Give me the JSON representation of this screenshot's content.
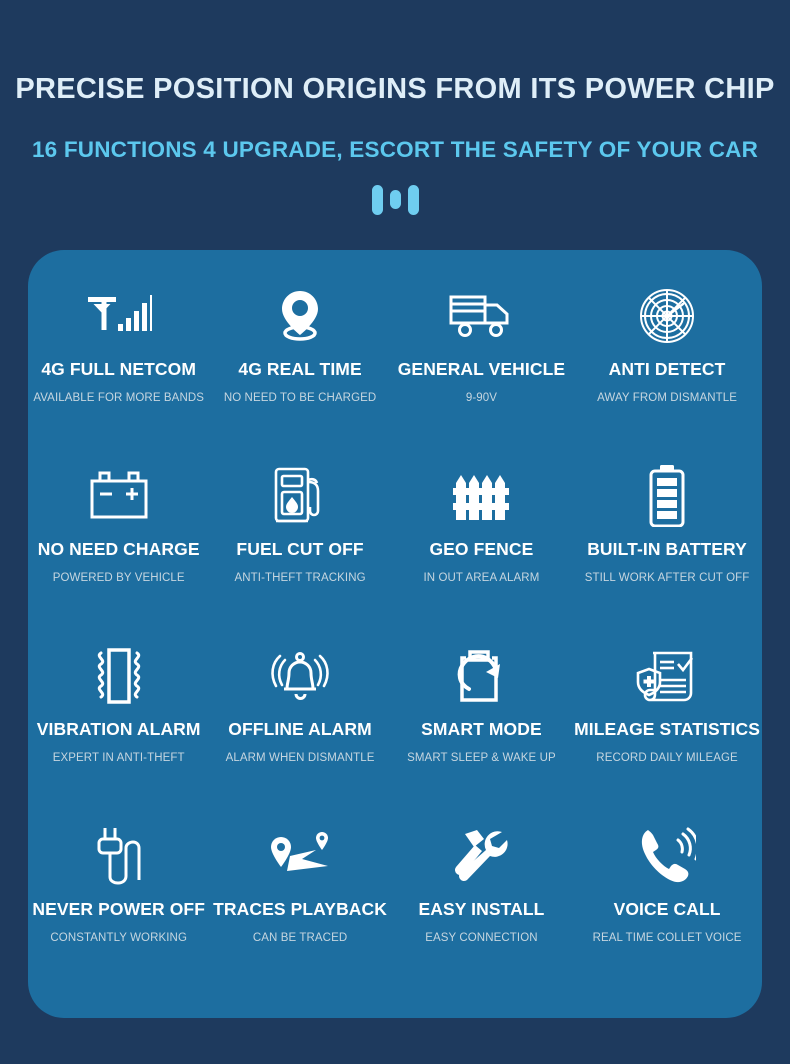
{
  "header": {
    "headline": "PRECISE POSITION ORIGINS FROM ITS POWER CHIP",
    "subheadline": "16 FUNCTIONS 4 UPGRADE, ESCORT THE SAFETY OF YOUR CAR",
    "decoration": "three-bar-mark"
  },
  "colors": {
    "page_background": "#1e3a5e",
    "card_background": "#1d6ea0",
    "headline_text": "#dfeef8",
    "subheadline_text": "#5cc8ee",
    "accent": "#6fcdf0",
    "feature_title_text": "#ffffff",
    "feature_subtitle_text": "#c6d6e0"
  },
  "features": [
    {
      "icon": "signal-bars-icon",
      "title": "4G FULL NETCOM",
      "subtitle": "AVAILABLE FOR MORE BANDS"
    },
    {
      "icon": "location-pin-icon",
      "title": "4G REAL TIME",
      "subtitle": "NO NEED TO BE CHARGED"
    },
    {
      "icon": "truck-icon",
      "title": "GENERAL VEHICLE",
      "subtitle": "9-90V"
    },
    {
      "icon": "radar-icon",
      "title": "ANTI DETECT",
      "subtitle": "AWAY FROM DISMANTLE"
    },
    {
      "icon": "car-battery-icon",
      "title": "NO NEED CHARGE",
      "subtitle": "POWERED BY VEHICLE"
    },
    {
      "icon": "fuel-pump-icon",
      "title": "FUEL CUT OFF",
      "subtitle": "ANTI-THEFT TRACKING"
    },
    {
      "icon": "fence-icon",
      "title": "GEO FENCE",
      "subtitle": "IN OUT AREA ALARM"
    },
    {
      "icon": "battery-icon",
      "title": "BUILT-IN BATTERY",
      "subtitle": "STILL WORK AFTER CUT OFF"
    },
    {
      "icon": "vibration-icon",
      "title": "VIBRATION ALARM",
      "subtitle": "EXPERT IN ANTI-THEFT"
    },
    {
      "icon": "ringing-bell-icon",
      "title": "OFFLINE ALARM",
      "subtitle": "ALARM WHEN DISMANTLE"
    },
    {
      "icon": "clipboard-refresh-icon",
      "title": "SMART MODE",
      "subtitle": "SMART SLEEP & WAKE UP"
    },
    {
      "icon": "document-check-icon",
      "title": "MILEAGE STATISTICS",
      "subtitle": "RECORD DAILY MILEAGE"
    },
    {
      "icon": "power-plug-icon",
      "title": "NEVER POWER OFF",
      "subtitle": "CONSTANTLY WORKING"
    },
    {
      "icon": "route-track-icon",
      "title": "TRACES PLAYBACK",
      "subtitle": "CAN BE TRACED"
    },
    {
      "icon": "tools-icon",
      "title": "EASY INSTALL",
      "subtitle": "EASY CONNECTION"
    },
    {
      "icon": "phone-call-icon",
      "title": "VOICE CALL",
      "subtitle": "REAL TIME COLLET VOICE"
    }
  ]
}
